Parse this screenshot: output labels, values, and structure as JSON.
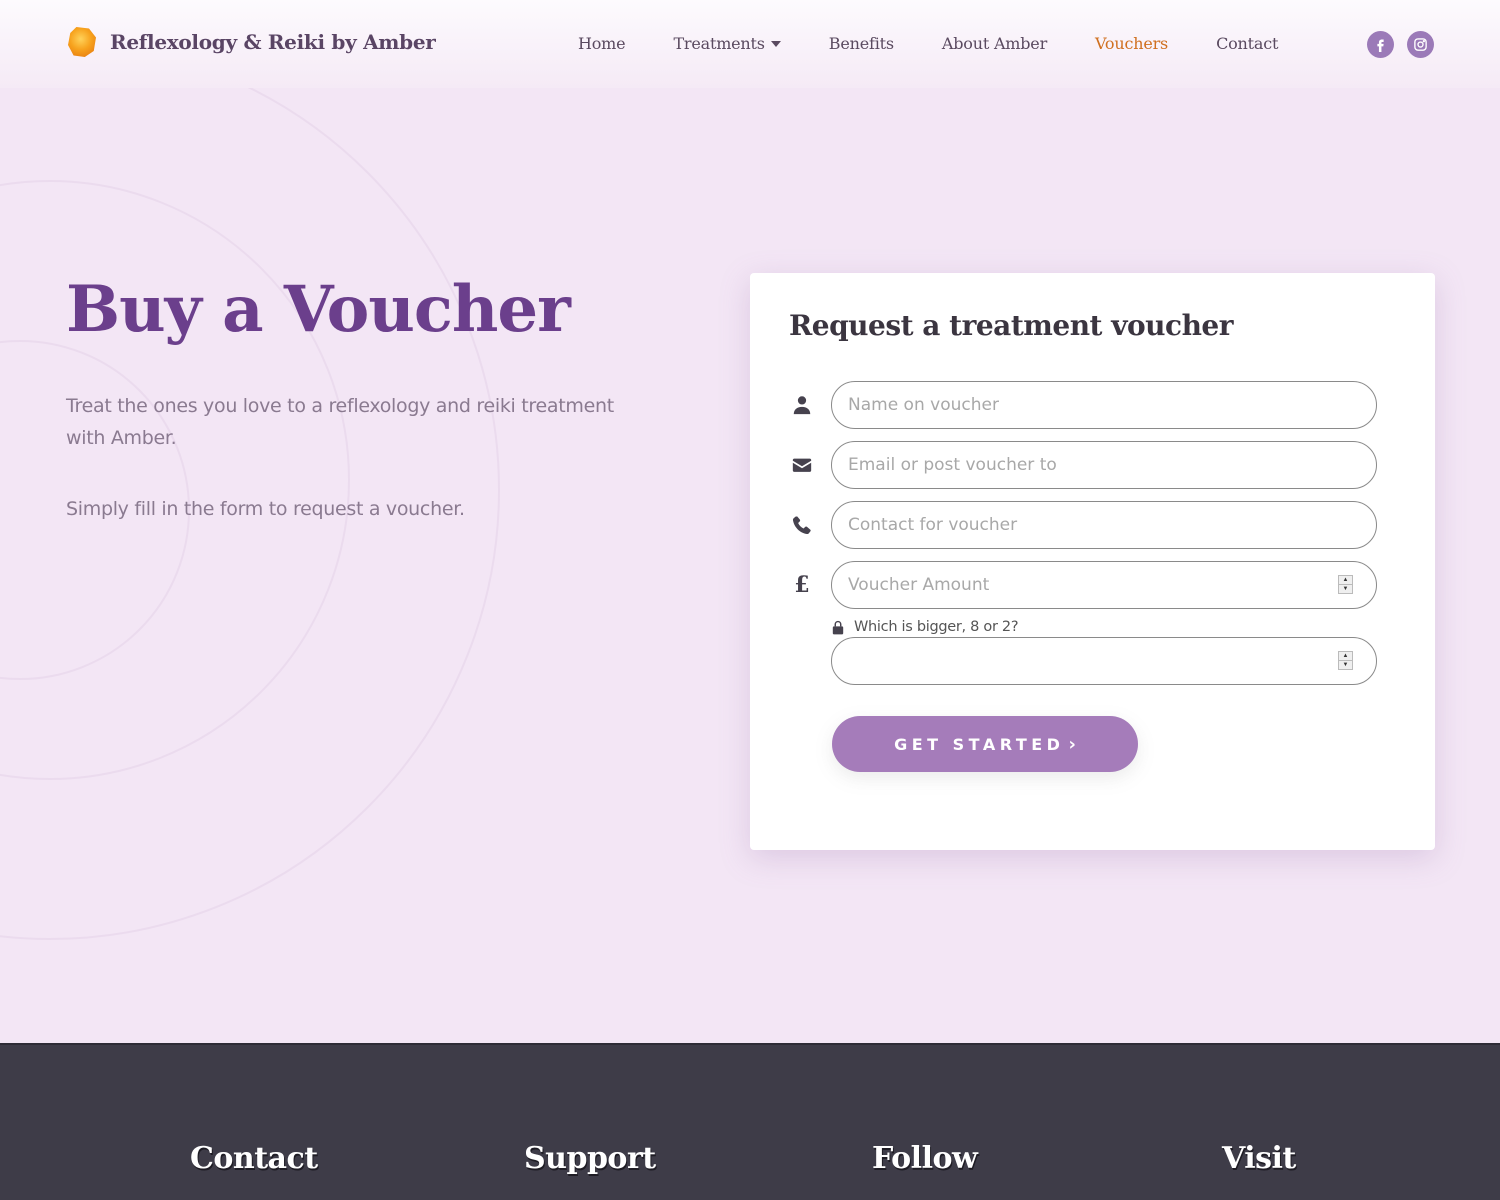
{
  "header": {
    "brand": "Reflexology & Reiki by Amber",
    "nav": [
      {
        "label": "Home"
      },
      {
        "label": "Treatments",
        "has_dropdown": true
      },
      {
        "label": "Benefits"
      },
      {
        "label": "About Amber"
      },
      {
        "label": "Vouchers",
        "active": true
      },
      {
        "label": "Contact"
      }
    ],
    "social": [
      "facebook-icon",
      "instagram-icon"
    ]
  },
  "hero": {
    "title": "Buy a Voucher",
    "paragraph1": "Treat the ones you love to a reflexology and reiki treatment with Amber.",
    "paragraph2": "Simply fill in the form to request a voucher."
  },
  "form": {
    "title": "Request a treatment voucher",
    "fields": [
      {
        "icon": "user-icon",
        "placeholder": "Name on voucher",
        "value": ""
      },
      {
        "icon": "envelope-icon",
        "placeholder": "Email or post voucher to",
        "value": ""
      },
      {
        "icon": "phone-icon",
        "placeholder": "Contact for voucher",
        "value": ""
      },
      {
        "icon": "pound-icon",
        "symbol": "£",
        "placeholder": "Voucher Amount",
        "value": ""
      }
    ],
    "captcha": {
      "label": "Which is bigger, 8 or 2?",
      "value": ""
    },
    "submit_label": "GET STARTED",
    "submit_chevron": "›"
  },
  "footer": {
    "columns": [
      "Contact",
      "Support",
      "Follow",
      "Visit"
    ]
  },
  "colors": {
    "background": "#f3e6f5",
    "heading": "#6b3f8c",
    "active_nav": "#d07020",
    "button": "#a57cba",
    "footer": "#3e3c48"
  }
}
